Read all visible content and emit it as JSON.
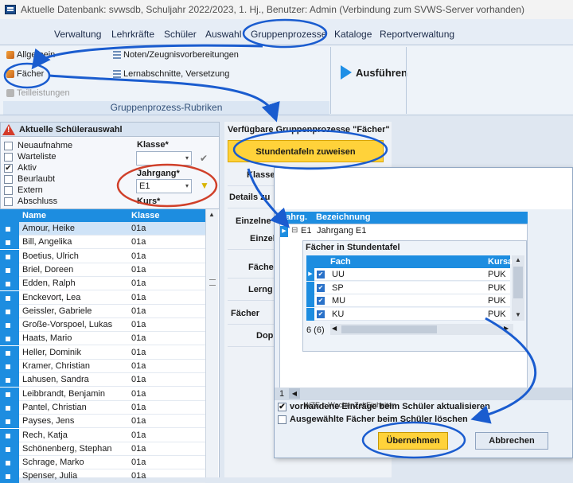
{
  "window": {
    "title": "Aktuelle Datenbank: svwsdb, Schuljahr 2022/2023, 1. Hj., Benutzer: Admin (Verbindung zum SVWS-Server vorhanden)"
  },
  "menu": {
    "items": [
      "Verwaltung",
      "Lehrkräfte",
      "Schüler",
      "Auswahl",
      "Gruppenprozesse",
      "Kataloge",
      "Reportverwaltung"
    ]
  },
  "ribbon": {
    "allgemein": "Allgemein",
    "faecher": "Fächer",
    "teilleistungen": "Teilleistungen",
    "noten": "Noten/Zeugnisvorbereitungen",
    "lernabschnitte": "Lernabschnitte, Versetzung",
    "group_label": "Gruppenprozess-Rubriken",
    "ausfuehren": "Ausführen"
  },
  "selection_panel": {
    "title": "Aktuelle Schülerauswahl",
    "status_options": [
      {
        "label": "Neuaufnahme",
        "checked": false
      },
      {
        "label": "Warteliste",
        "checked": false
      },
      {
        "label": "Aktiv",
        "checked": true
      },
      {
        "label": "Beurlaubt",
        "checked": false
      },
      {
        "label": "Extern",
        "checked": false
      },
      {
        "label": "Abschluss",
        "checked": false
      }
    ],
    "klasse_label": "Klasse*",
    "klasse_value": "",
    "jahrgang_label": "Jahrgang*",
    "jahrgang_value": "E1",
    "kurs_label": "Kurs*"
  },
  "student_list": {
    "headers": {
      "name": "Name",
      "klasse": "Klasse"
    },
    "rows": [
      {
        "name": "Amour, Heike",
        "klasse": "01a"
      },
      {
        "name": "Bill, Angelika",
        "klasse": "01a"
      },
      {
        "name": "Boetius, Ulrich",
        "klasse": "01a"
      },
      {
        "name": "Briel, Doreen",
        "klasse": "01a"
      },
      {
        "name": "Edden, Ralph",
        "klasse": "01a"
      },
      {
        "name": "Enckevort, Lea",
        "klasse": "01a"
      },
      {
        "name": "Geissler, Gabriele",
        "klasse": "01a"
      },
      {
        "name": "Große-Vorspoel, Lukas",
        "klasse": "01a"
      },
      {
        "name": "Haats, Mario",
        "klasse": "01a"
      },
      {
        "name": "Heller, Dominik",
        "klasse": "01a"
      },
      {
        "name": "Kramer, Christian",
        "klasse": "01a"
      },
      {
        "name": "Lahusen, Sandra",
        "klasse": "01a"
      },
      {
        "name": "Leibbrandt, Benjamin",
        "klasse": "01a"
      },
      {
        "name": "Pantel, Christian",
        "klasse": "01a"
      },
      {
        "name": "Payses, Jens",
        "klasse": "01a"
      },
      {
        "name": "Rech, Katja",
        "klasse": "01a"
      },
      {
        "name": "Schönenberg, Stephan",
        "klasse": "01a"
      },
      {
        "name": "Schrage, Marko",
        "klasse": "01a"
      },
      {
        "name": "Spenser, Julia",
        "klasse": "01a"
      }
    ]
  },
  "processes": {
    "title": "Verfügbare Gruppenprozesse \"Fächer\"",
    "buttons": [
      "Stundentafeln zuweisen",
      "Klasse",
      "Details zu",
      "Einzelne F",
      "Einzel",
      "Fächer",
      "Lerng",
      "Fächer aus",
      "Dop"
    ]
  },
  "dialog": {
    "grid_headers": {
      "jahrg": "Jahrg.",
      "bezeichnung": "Bezeichnung"
    },
    "grid_row": {
      "jahrg": "E1",
      "bezeichnung": "Jahrgang E1"
    },
    "inner_title": "Fächer in Stundentafel",
    "inner_headers": {
      "fach": "Fach",
      "kursart": "Kursar"
    },
    "faecher": [
      {
        "fach": "UU",
        "kursart": "PUK"
      },
      {
        "fach": "SP",
        "kursart": "PUK"
      },
      {
        "fach": "MU",
        "kursart": "PUK"
      },
      {
        "fach": "KU",
        "kursart": "PUK"
      }
    ],
    "count": "6 (6)",
    "legend": "WZE = WochenZeitEinheiten",
    "page": "1",
    "option_update": "vorhandene Einträge beim Schüler aktualisieren",
    "option_update_checked": true,
    "option_delete": "Ausgewählte Fächer beim Schüler löschen",
    "option_delete_checked": false,
    "ok_label": "Übernehmen",
    "cancel_label": "Abbrechen"
  },
  "colors": {
    "accent": "#1d8de0",
    "highlight": "#ffd23a",
    "annotation_blue": "#1a5ccf",
    "annotation_red": "#d0402a"
  }
}
